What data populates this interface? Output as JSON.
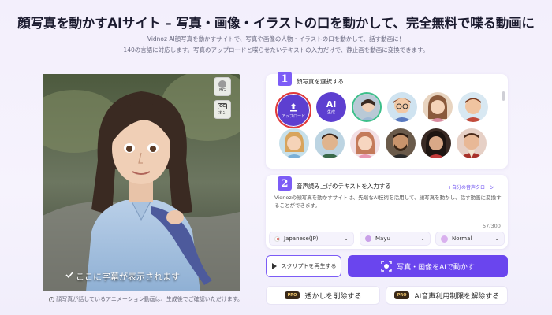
{
  "header": {
    "title": "顔写真を動かすAIサイト – 写真・画像・イラストの口を動かして、完全無料で喋る動画に",
    "subtitle_line1": "Vidnoz AI顔写真を動かすサイトで、写真や画像の人物・イラストの口を動かして、話す動画に！",
    "subtitle_line2": "140の言語に対応します。写真のアップロードと喋らせたいテキストの入力だけで、静止画を動画に変換できます。"
  },
  "video": {
    "side_buttons": [
      {
        "icon": "background-icon",
        "label": "BG"
      },
      {
        "icon": "caption-icon",
        "label": "オン",
        "badge": "CC"
      }
    ],
    "caption": "ここに字幕が表示されます",
    "note": "顔写真が話しているアニメーション動画は、生成後でご確認いただけます。"
  },
  "step1": {
    "number": "1",
    "title": "顔写真を選択する",
    "upload_label": "アップロード",
    "ai_label": "AI",
    "ai_sub": "生成",
    "avatars": [
      {
        "name": "avatar-woman-photo",
        "color": "#b9c9d6"
      },
      {
        "name": "avatar-boy-glasses",
        "color": "#d49a76"
      },
      {
        "name": "avatar-girl-brown-hair",
        "color": "#8a5a3c"
      },
      {
        "name": "avatar-boy-cartoon",
        "color": "#c88a62"
      },
      {
        "name": "avatar-girl-blonde",
        "color": "#d8a45c"
      },
      {
        "name": "avatar-boy-dark",
        "color": "#6b4a34"
      },
      {
        "name": "avatar-girl-pink",
        "color": "#c47a5a"
      },
      {
        "name": "avatar-man-bearded",
        "color": "#4a3526"
      },
      {
        "name": "avatar-woman-traditional",
        "color": "#2e2320"
      },
      {
        "name": "avatar-man-red",
        "color": "#a8322a"
      }
    ]
  },
  "step2": {
    "number": "2",
    "title": "音声読み上げのテキストを入力する",
    "voice_link": "+自分の音声クローン",
    "script": "Vidnozの顔写真を動かすサイトは、先端なAI技術を活用して、顔写真を動かし、話す動画に変換することができます。",
    "char_count": "57/300",
    "language": "Japanese(JP)",
    "voice": "Mayu",
    "speed": "Normal"
  },
  "actions": {
    "play_label": "スクリプトを再生する",
    "animate_label": "写真・画像をAIで動かす",
    "remove_watermark_label": "透かしを削除する",
    "remove_limit_label": "AI音声利用制限を解除する",
    "pro_badge": "PRO"
  },
  "colors": {
    "accent": "#6a45ee",
    "upload_ring": "#e23a3a"
  }
}
